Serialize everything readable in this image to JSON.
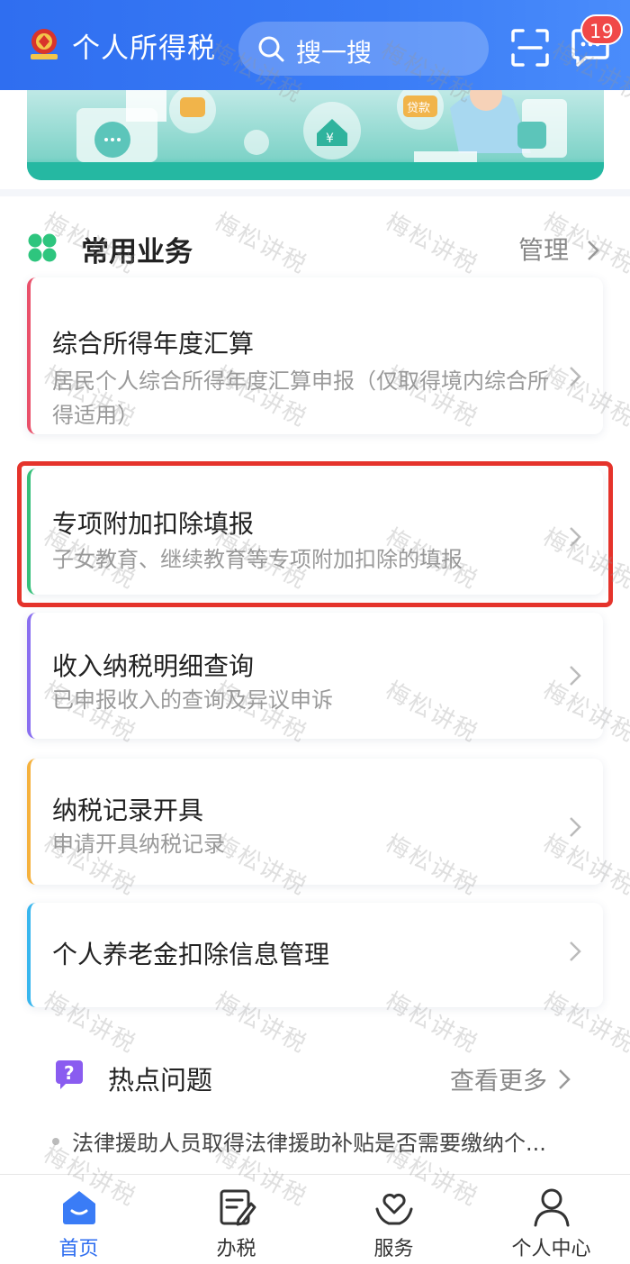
{
  "header": {
    "title": "个人所得税",
    "search_placeholder": "搜一搜",
    "badge_count": "19"
  },
  "banner": {
    "tag_loan": "贷款",
    "tag_house": "¥"
  },
  "common_services": {
    "title": "常用业务",
    "manage_label": "管理",
    "items": [
      {
        "title": "综合所得年度汇算",
        "desc": "居民个人综合所得年度汇算申报（仅取得境内综合所得适用）",
        "accent": "#e9506a"
      },
      {
        "title": "专项附加扣除填报",
        "desc": "子女教育、继续教育等专项附加扣除的填报",
        "accent": "#35c07a"
      },
      {
        "title": "收入纳税明细查询",
        "desc": "已申报收入的查询及异议申诉",
        "accent": "#8a6ff0"
      },
      {
        "title": "纳税记录开具",
        "desc": "申请开具纳税记录",
        "accent": "#f5b13d"
      },
      {
        "title": "个人养老金扣除信息管理",
        "desc": "",
        "accent": "#38b6ee"
      }
    ]
  },
  "hot_questions": {
    "title": "热点问题",
    "view_more": "查看更多",
    "items": [
      "法律援助人员取得法律援助补贴是否需要缴纳个..."
    ]
  },
  "bottom_nav": [
    {
      "label": "首页",
      "icon": "home-icon",
      "active": true
    },
    {
      "label": "办税",
      "icon": "tax-doc-icon",
      "active": false
    },
    {
      "label": "服务",
      "icon": "heart-hands-icon",
      "active": false
    },
    {
      "label": "个人中心",
      "icon": "person-icon",
      "active": false
    }
  ],
  "watermark": "梅松讲税",
  "colors": {
    "brand_blue": "#2f6ef0",
    "highlight_red": "#e5332b",
    "banner_teal": "#2bbfa9"
  }
}
